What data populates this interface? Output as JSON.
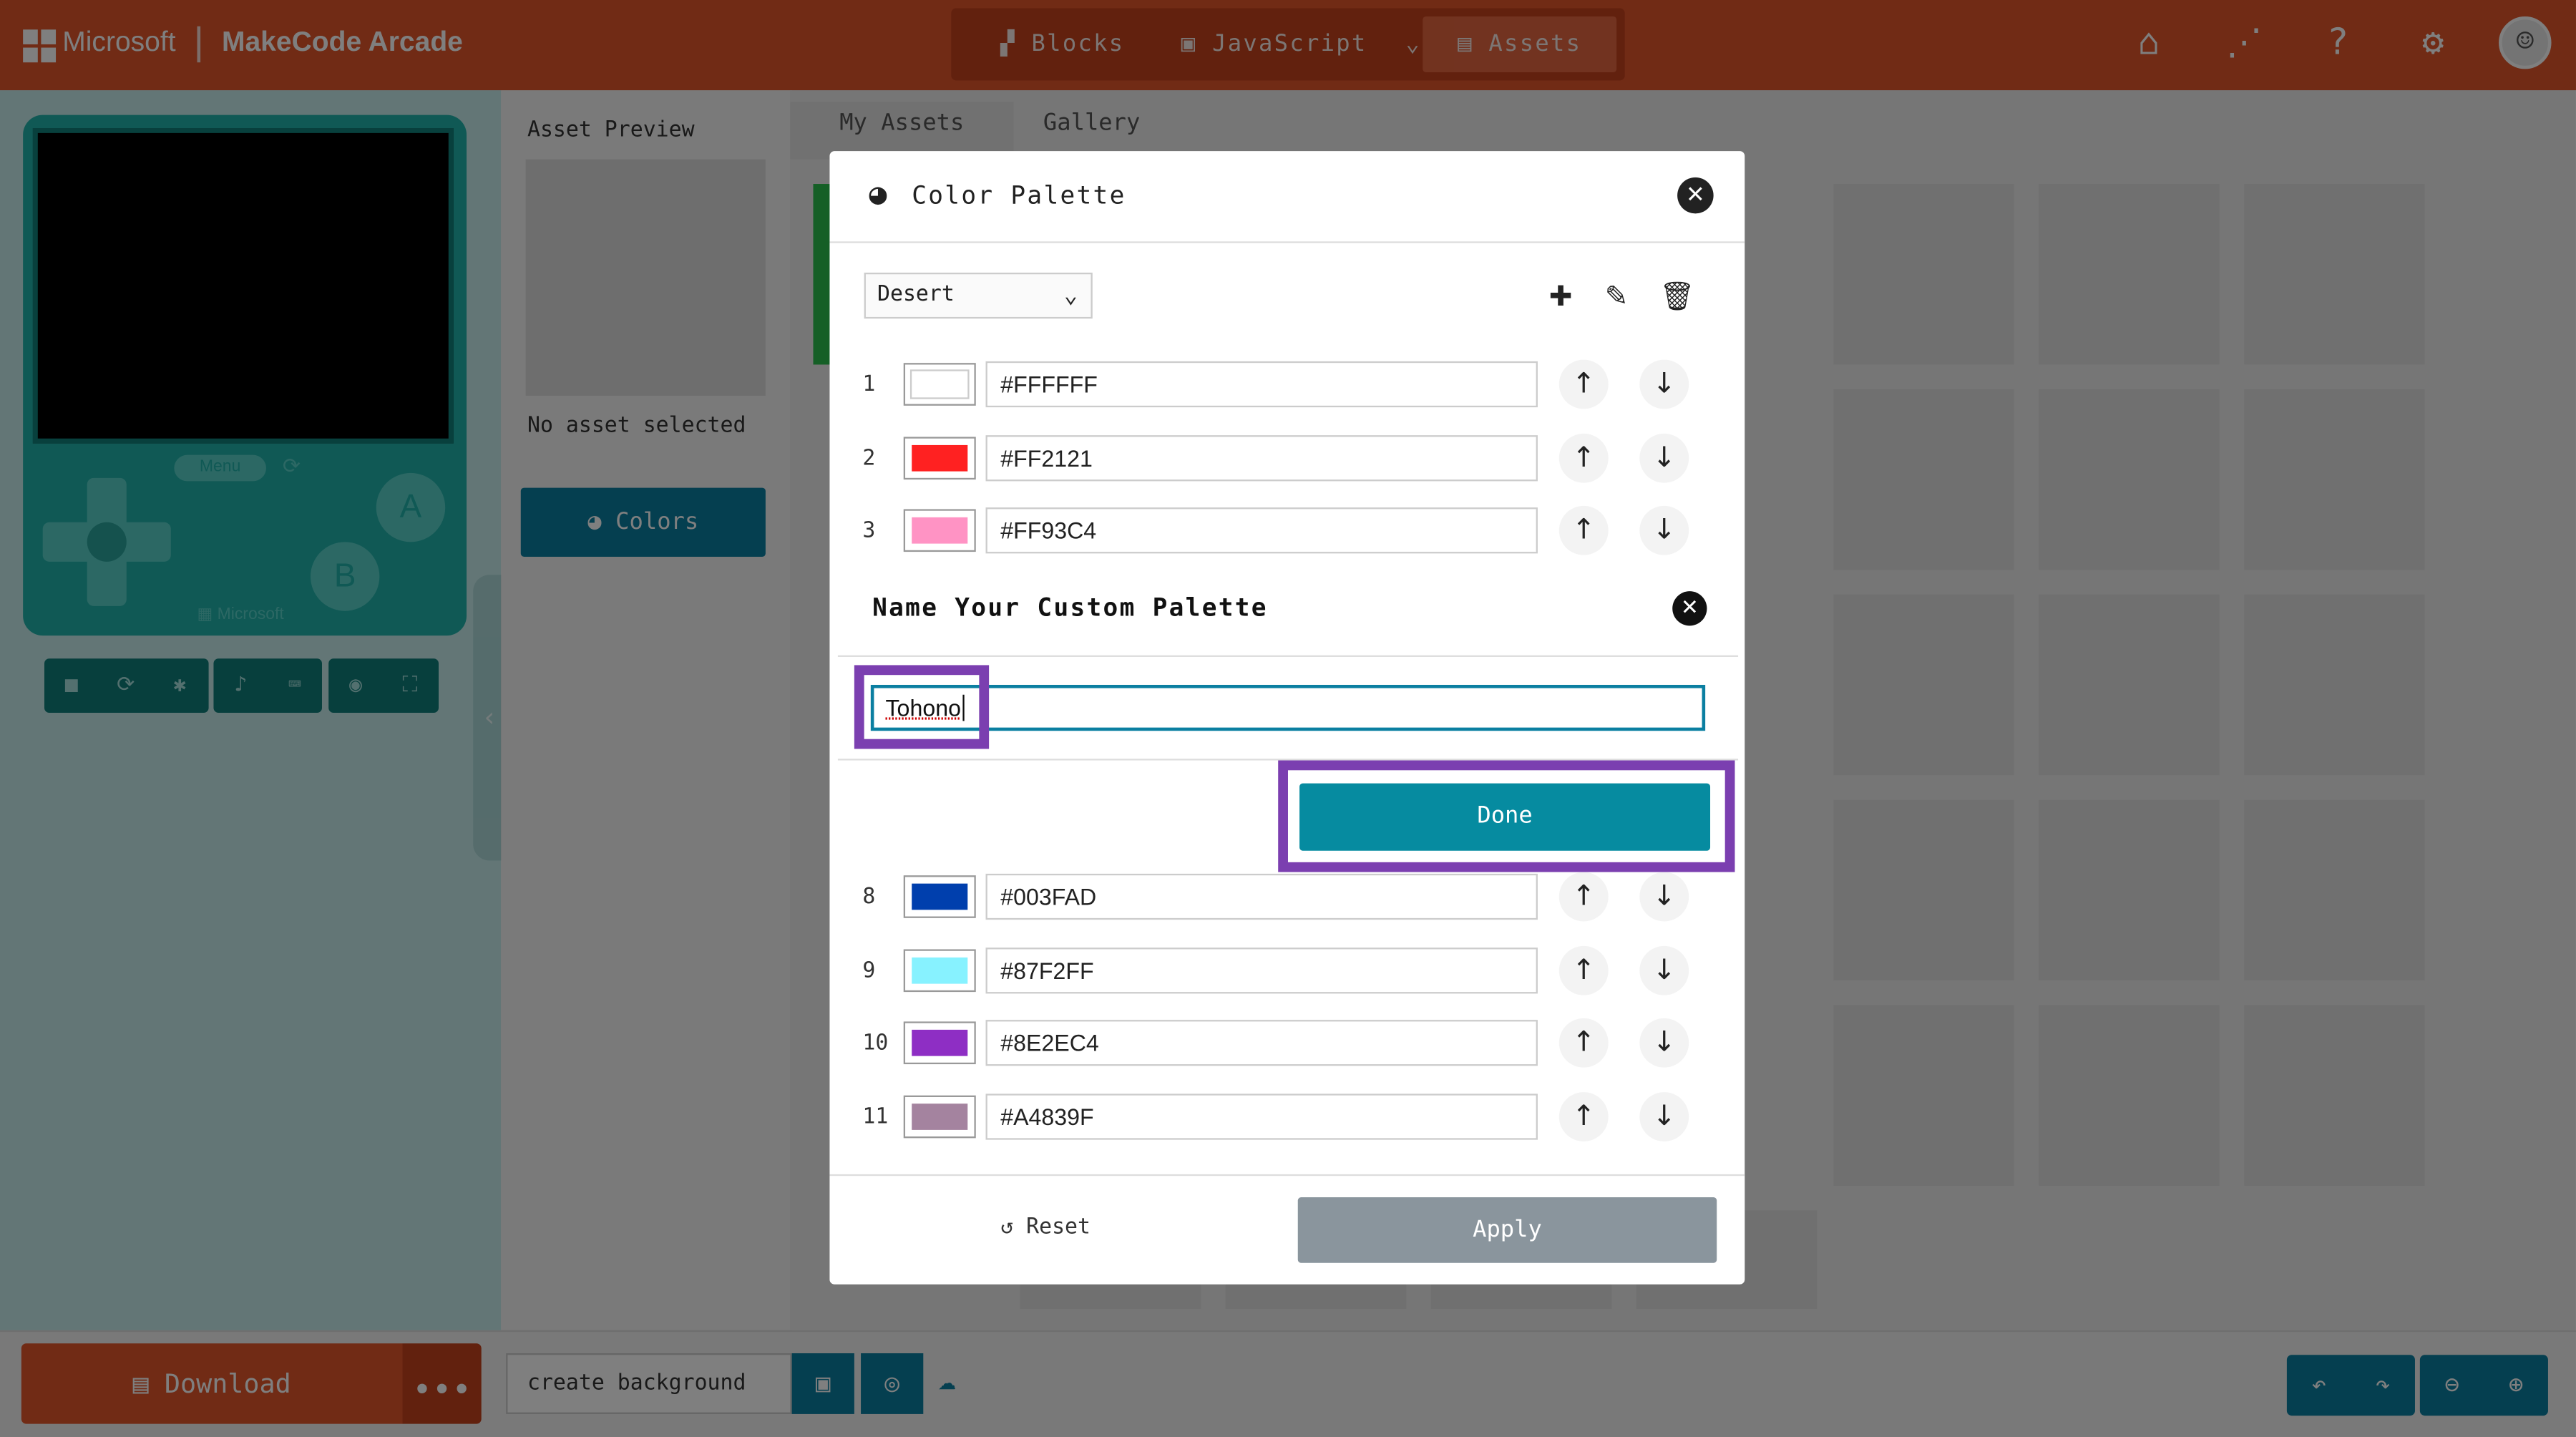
{
  "header": {
    "brand_ms": "Microsoft",
    "brand_app": "MakeCode Arcade",
    "tabs": [
      {
        "label": "Blocks",
        "icon": "puzzle-icon"
      },
      {
        "label": "JavaScript",
        "icon": "js-icon"
      },
      {
        "label": "Assets",
        "icon": "image-icon",
        "active": true
      }
    ],
    "icons": [
      "home-icon",
      "share-icon",
      "help-icon",
      "settings-icon",
      "user-avatar-icon"
    ]
  },
  "simulator": {
    "menu_label": "Menu",
    "button_a": "A",
    "button_b": "B",
    "brand": "Microsoft",
    "toolbar_icons": [
      "stop-icon",
      "restart-icon",
      "debug-icon",
      "sound-icon",
      "keyboard-icon",
      "screenshot-icon",
      "fullscreen-icon"
    ]
  },
  "asset_panel": {
    "preview_title": "Asset Preview",
    "no_asset": "No asset selected",
    "colors_button": "Colors"
  },
  "gallery": {
    "tabs": [
      "My Assets",
      "Gallery"
    ]
  },
  "palette_dialog": {
    "title": "Color Palette",
    "selected_palette": "Desert",
    "colors": [
      {
        "index": "1",
        "hex": "#FFFFFF"
      },
      {
        "index": "2",
        "hex": "#FF2121"
      },
      {
        "index": "3",
        "hex": "#FF93C4"
      },
      {
        "index": "8",
        "hex": "#003FAD"
      },
      {
        "index": "9",
        "hex": "#87F2FF"
      },
      {
        "index": "10",
        "hex": "#8E2EC4"
      },
      {
        "index": "11",
        "hex": "#A4839F"
      }
    ],
    "reset_label": "Reset",
    "apply_label": "Apply"
  },
  "name_dialog": {
    "title": "Name Your Custom Palette",
    "input_value": "Tohono",
    "done_label": "Done"
  },
  "bottom_bar": {
    "download_label": "Download",
    "project_name": "create background"
  },
  "colors": {
    "brand_orange": "#e2562a",
    "teal": "#20b2aa",
    "highlight_purple": "#7b3fb0",
    "primary_blue": "#0b7fa1"
  }
}
